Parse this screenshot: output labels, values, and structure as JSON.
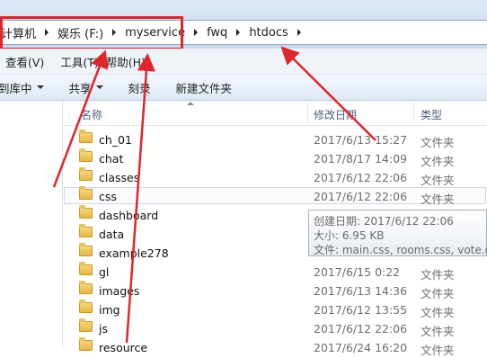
{
  "address": {
    "breadcrumbs": [
      "计算机",
      "娱乐 (F:)",
      "myservice",
      "fwq",
      "htdocs"
    ]
  },
  "menu": [
    "查看(V)",
    "工具(T)",
    "帮助(H)"
  ],
  "toolbar": {
    "include_library": "到库中",
    "share": "共享",
    "burn": "刻录",
    "new_folder": "新建文件夹"
  },
  "columns": {
    "name": "名称",
    "modified": "修改日期",
    "type": "类型"
  },
  "files": [
    {
      "name": "ch_01",
      "date": "2017/6/13 15:27",
      "type": "文件夹"
    },
    {
      "name": "chat",
      "date": "2017/8/17 14:09",
      "type": "文件夹"
    },
    {
      "name": "classes",
      "date": "2017/6/12 22:06",
      "type": "文件夹"
    },
    {
      "name": "css",
      "date": "2017/6/12 22:06",
      "type": "文件夹"
    },
    {
      "name": "dashboard",
      "date": "",
      "type": ""
    },
    {
      "name": "data",
      "date": "",
      "type": ""
    },
    {
      "name": "example278",
      "date": "",
      "type": ""
    },
    {
      "name": "gl",
      "date": "2017/6/15 0:22",
      "type": "文件夹"
    },
    {
      "name": "images",
      "date": "2017/6/13 14:36",
      "type": "文件夹"
    },
    {
      "name": "img",
      "date": "2017/6/12 13:55",
      "type": "文件夹"
    },
    {
      "name": "js",
      "date": "2017/6/12 22:06",
      "type": "文件夹"
    },
    {
      "name": "resource",
      "date": "2017/6/24 16:20",
      "type": "文件夹"
    }
  ],
  "tooltip": {
    "line1": "创建日期: 2017/6/12 22:06",
    "line2": "大小: 6.95 KB",
    "line3": "文件: main.css, rooms.css, vote.css"
  },
  "colors": {
    "highlight": "#e0262a",
    "arrow": "#e0262a"
  }
}
